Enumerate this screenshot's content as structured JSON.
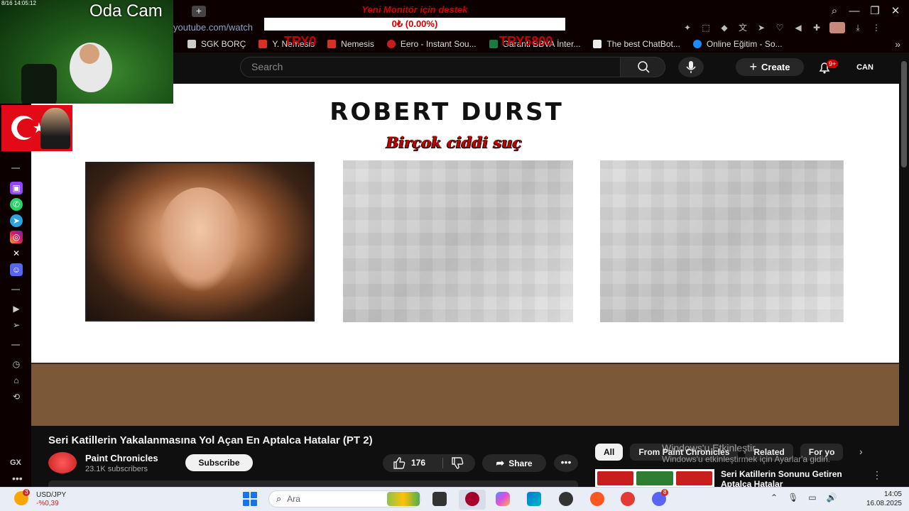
{
  "browser": {
    "url": "youtube.com/watch",
    "window_controls": {
      "search": "⌕",
      "minimize": "—",
      "restore": "❐",
      "close": "✕"
    },
    "bookmarks": [
      {
        "label": "SGK BORÇ",
        "color": "#cccccc"
      },
      {
        "label": "Y. Nemesis",
        "color": "#d93025"
      },
      {
        "label": "Nemesis",
        "color": "#d93025"
      },
      {
        "label": "Eero - Instant Sou...",
        "color": "#c41e1e"
      },
      {
        "label": "Garanti BBVA İnter...",
        "color": "#1d7a3c"
      },
      {
        "label": "The best ChatBot...",
        "color": "#eeeeee"
      },
      {
        "label": "Online Eğitim - So...",
        "color": "#1a8cff"
      }
    ],
    "bookmarks_more": "»"
  },
  "stream_overlay": {
    "webcam_label": "Oda Cam",
    "webcam_time": "8/16 14:05:12",
    "donation_title": "Yeni Monitör için destek",
    "donation_progress_text": "0₺ (0.00%)",
    "donation_progress": 0,
    "goal_left": "TRY0",
    "goal_right": "TRY5800"
  },
  "sidebar": {
    "label": "GX",
    "more": "•••"
  },
  "youtube_header": {
    "search_placeholder": "Search",
    "create_label": "Create",
    "notification_count": "9+",
    "avatar_text": "CAN"
  },
  "video_frame": {
    "title": "ROBERT DURST",
    "subtitle": "Birçok ciddi suç"
  },
  "video_info": {
    "title": "Seri Katillerin Yakalanmasına Yol Açan En Aptalca Hatalar (PT 2)",
    "channel_name": "Paint Chronicles",
    "subscribers": "23.1K subscribers",
    "subscribe_label": "Subscribe",
    "likes": "176",
    "share_label": "Share",
    "more": "•••"
  },
  "chips": [
    {
      "label": "All",
      "active": true
    },
    {
      "label": "From Paint Chronicles",
      "active": false
    },
    {
      "label": "Related",
      "active": false
    },
    {
      "label": "For yo",
      "active": false
    }
  ],
  "related": {
    "title": "Seri Katillerin Sonunu Getiren Aptalca Hatalar"
  },
  "windows_watermark": {
    "line1": "Windows'u Etkinleştir",
    "line2": "Windows'u etkinleştirmek için Ayarlar'a gidin."
  },
  "taskbar": {
    "weather_badge": "3",
    "ticker_label": "USD/JPY",
    "ticker_value": "-%0,39",
    "search_placeholder": "Ara",
    "time": "14:05",
    "date": "16.08.2025",
    "badge_count": "8"
  }
}
